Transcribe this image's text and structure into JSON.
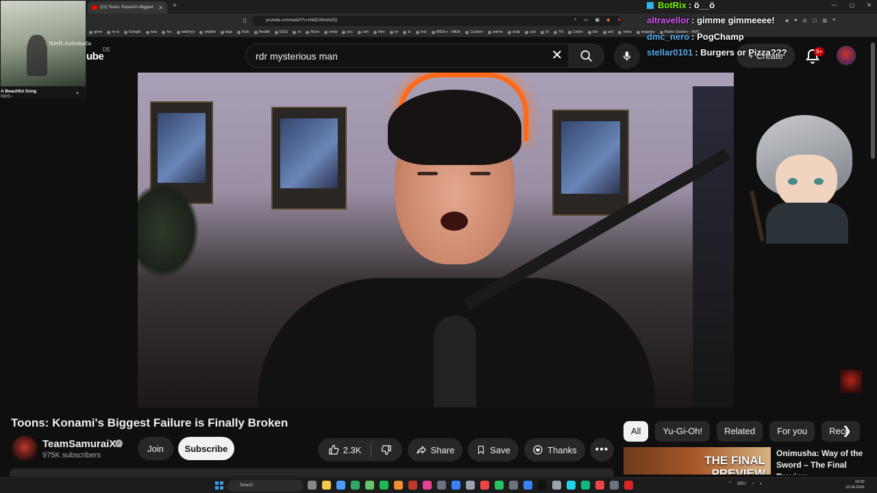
{
  "browser": {
    "tab_title": "(21) Toons: Konami's Biggest",
    "new_tab": "+",
    "url": "youtube.com/watch?v=nNdCz8mdxOQ",
    "bookmarks": [
      "gmm",
      "re ai",
      "Google",
      "was",
      "fec",
      "twitchyy",
      "ytbbbb",
      "tags",
      "Kick",
      "Reddit",
      "GGG",
      "re",
      "Runs",
      "eneb",
      "soc",
      "zon",
      "Nex",
      "wr",
      "tc",
      "Inst",
      "IMDb s - IMDb",
      "Custom",
      "anime",
      "arab",
      "sub",
      "St",
      "Tik",
      "Listen",
      "Ele",
      "acti",
      "meta",
      "mapppp",
      "Radio Garden – AMC"
    ]
  },
  "youtube": {
    "logo_fragment": "ube",
    "country": "DE",
    "search_value": "rdr mysterious man",
    "create_label": "Create",
    "notifications": "9+"
  },
  "album": {
    "logo": "NieR:Automata",
    "title": "A Beautiful Song",
    "artist": "岡部啓一"
  },
  "chat": [
    {
      "user": "BotRix",
      "msg": "ö__ö",
      "color": "#7CFC00",
      "bot": true
    },
    {
      "user": "altravellor",
      "msg": "gimme gimmeeee!",
      "color": "#D55BF5",
      "bot": false
    },
    {
      "user": "dmc_nero",
      "msg": "PogChamp",
      "color": "#5AB0F0",
      "bot": false
    },
    {
      "user": "stellar0101",
      "msg": "Burgers or Pizza???",
      "color": "#5AB0F0",
      "bot": false
    }
  ],
  "video": {
    "title": "Toons: Konami's Biggest Failure is Finally Broken",
    "channel": "TeamSamuraiX1",
    "subscribers": "975K subscribers",
    "join": "Join",
    "subscribe": "Subscribe",
    "likes": "2.3K",
    "share": "Share",
    "save": "Save",
    "thanks": "Thanks"
  },
  "chips": [
    "All",
    "Yu-Gi-Oh!",
    "Related",
    "For you",
    "Rece"
  ],
  "recommendation": {
    "thumb_text_1": "THE FINAL",
    "thumb_text_2": "PREVIEW",
    "title": "Onimusha: Way of the Sword – The Final Preview"
  },
  "taskbar": {
    "search": "Search",
    "lang": "DEU",
    "time": "16:30",
    "date": "10.08.2026"
  },
  "colors": {
    "background": "#0f0f0f",
    "pill": "#272727",
    "accent_red": "#ff0000"
  }
}
